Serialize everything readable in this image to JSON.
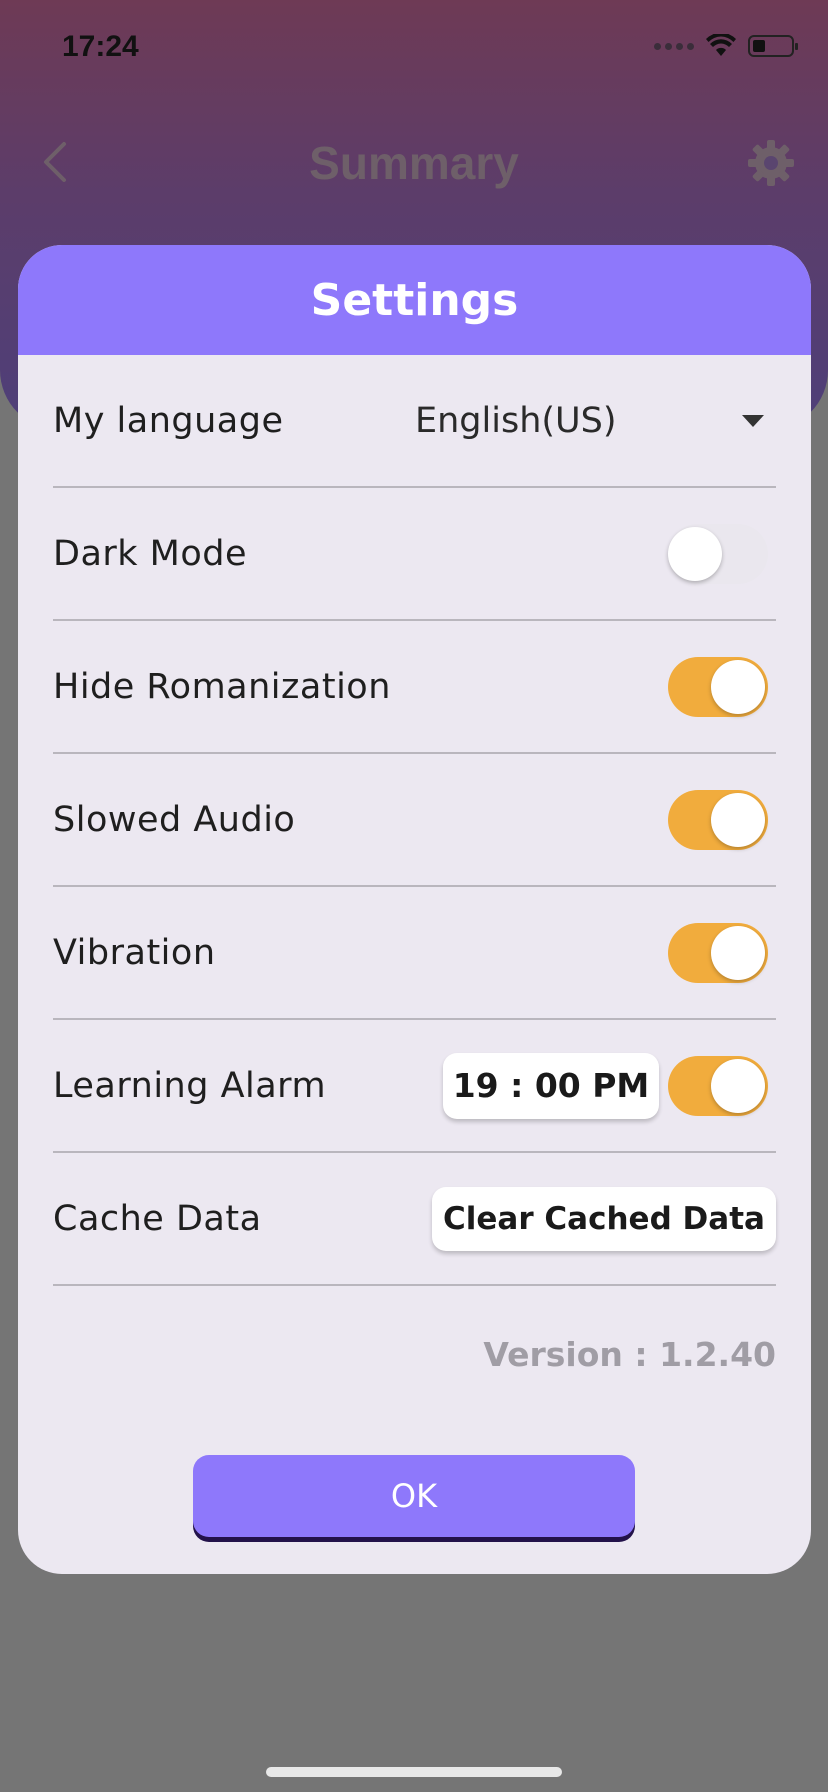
{
  "status_bar": {
    "time": "17:24"
  },
  "app_header": {
    "title": "Summary"
  },
  "modal": {
    "title": "Settings",
    "language": {
      "label": "My language",
      "value": "English(US)"
    },
    "dark_mode": {
      "label": "Dark Mode",
      "on": false
    },
    "hide_romanization": {
      "label": "Hide Romanization",
      "on": true
    },
    "slowed_audio": {
      "label": "Slowed Audio",
      "on": true
    },
    "vibration": {
      "label": "Vibration",
      "on": true
    },
    "learning_alarm": {
      "label": "Learning Alarm",
      "time": "19 : 00 PM",
      "on": true
    },
    "cache_data": {
      "label": "Cache Data",
      "button": "Clear Cached Data"
    },
    "version": "Version : 1.2.40",
    "ok_button": "OK"
  },
  "colors": {
    "accent": "#8e78fb",
    "toggle_on": "#f1ac3d",
    "toggle_off": "#eae7ee"
  }
}
